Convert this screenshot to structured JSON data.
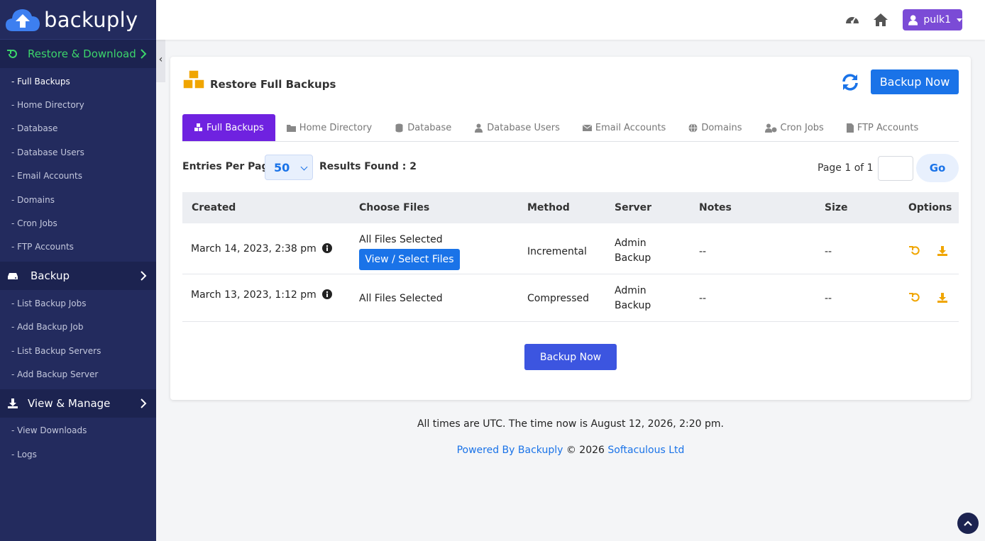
{
  "brand": {
    "name": "backuply"
  },
  "sidebar": {
    "sections": [
      {
        "label": "Restore & Download",
        "icon": "restore-icon",
        "items": [
          "- Full Backups",
          "- Home Directory",
          "- Database",
          "- Database Users",
          "- Email Accounts",
          "- Domains",
          "- Cron Jobs",
          "- FTP Accounts"
        ]
      },
      {
        "label": "Backup",
        "icon": "hard-drive-icon",
        "items": [
          "- List Backup Jobs",
          "- Add Backup Job",
          "- List Backup Servers",
          "- Add Backup Server"
        ]
      },
      {
        "label": "View & Manage",
        "icon": "download-icon",
        "items": [
          "- View Downloads",
          "- Logs"
        ]
      }
    ],
    "collapse_glyph": "‹"
  },
  "topbar": {
    "user": "pulk1",
    "icons": [
      "dashboard-icon",
      "home-icon",
      "user-icon"
    ]
  },
  "card": {
    "title": "Restore Full Backups",
    "backup_now": "Backup Now",
    "tabs": [
      "Full Backups",
      "Home Directory",
      "Database",
      "Database Users",
      "Email Accounts",
      "Domains",
      "Cron Jobs",
      "FTP Accounts"
    ],
    "entries_label": "Entries Per Page",
    "entries_value": "50",
    "results": "Results Found : 2",
    "page_label": "Page 1 of 1",
    "go": "Go",
    "columns": [
      "Created",
      "Choose Files",
      "Method",
      "Server",
      "Notes",
      "Size",
      "Options"
    ],
    "rows": [
      {
        "created": "March 14, 2023, 2:38 pm",
        "files": "All Files Selected",
        "view_btn": "View / Select Files",
        "method": "Incremental",
        "server_1": "Admin",
        "server_2": "Backup",
        "notes": "--",
        "size": "--"
      },
      {
        "created": "March 13, 2023, 1:12 pm",
        "files": "All Files Selected",
        "method": "Compressed",
        "server_1": "Admin",
        "server_2": "Backup",
        "notes": "--",
        "size": "--"
      }
    ],
    "backup_now_bottom": "Backup Now"
  },
  "footer": {
    "time": "All times are UTC. The time now is August 12, 2026, 2:20 pm.",
    "powered": "Powered By Backuply",
    "copy": "© 2026",
    "company": "Softaculous Ltd"
  },
  "colors": {
    "sidebar": "#232b5e",
    "active_section": "#3cd56b",
    "primary": "#1a73e8",
    "tab_active": "#6f22e0",
    "user_btn": "#7b4bd6",
    "option_icons": "#f0a500"
  }
}
